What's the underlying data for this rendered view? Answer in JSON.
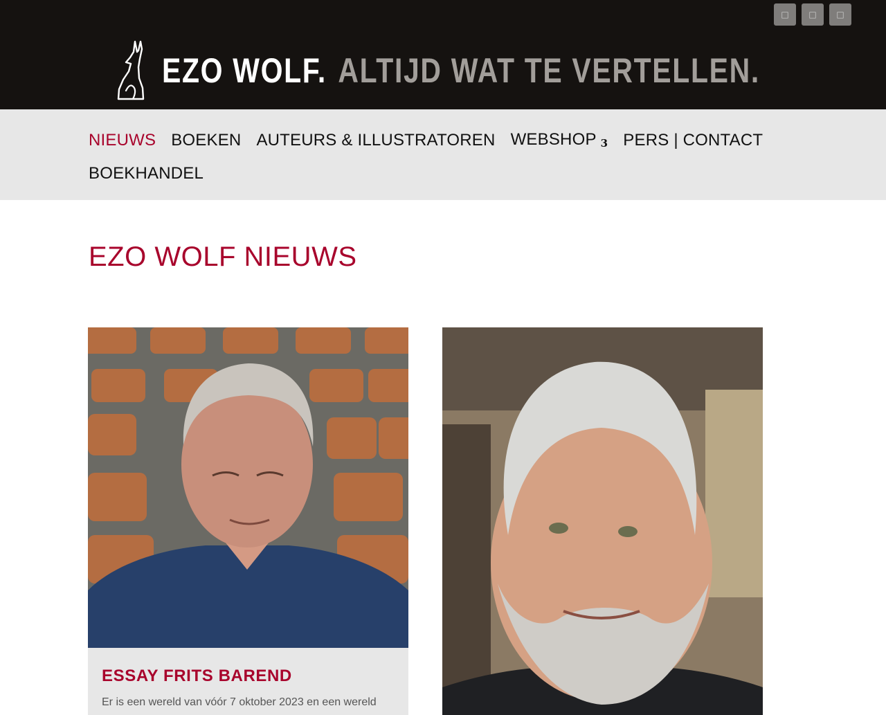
{
  "header": {
    "social_icons": [
      {
        "icon": "facebook-icon",
        "glyph": "□"
      },
      {
        "icon": "twitter-icon",
        "glyph": "□"
      },
      {
        "icon": "instagram-icon",
        "glyph": "□"
      }
    ],
    "logo": {
      "brand": "EZO WOLF.",
      "tagline": "ALTIJD WAT TE VERTELLEN."
    }
  },
  "nav": {
    "items": [
      {
        "label": "NIEUWS",
        "active": true
      },
      {
        "label": "BOEKEN"
      },
      {
        "label": "AUTEURS & ILLUSTRATOREN"
      },
      {
        "label": "WEBSHOP",
        "submenu_indicator": "3"
      },
      {
        "label": "PERS | CONTACT"
      },
      {
        "label": "BOEKHANDEL"
      }
    ]
  },
  "main": {
    "title": "EZO WOLF NIEUWS",
    "posts": [
      {
        "title": "ESSAY FRITS BAREND",
        "excerpt": "Er is een wereld van vóór 7 oktober 2023 en een wereld"
      },
      {
        "title": "",
        "excerpt": ""
      }
    ]
  },
  "colors": {
    "accent": "#a8042c",
    "header_bg": "#151210",
    "nav_bg": "#e7e7e7",
    "logo_tagline": "#a29e9a"
  }
}
